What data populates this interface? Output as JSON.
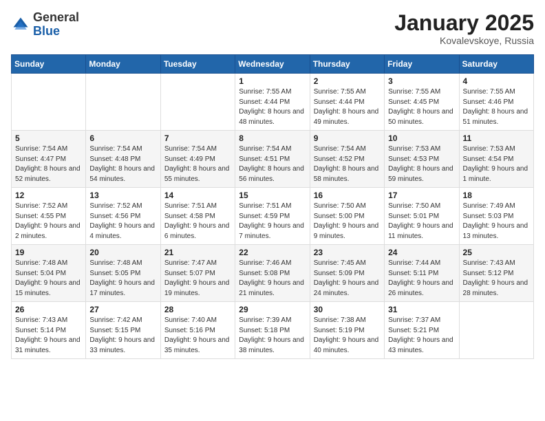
{
  "logo": {
    "general": "General",
    "blue": "Blue"
  },
  "header": {
    "month": "January 2025",
    "location": "Kovalevskoye, Russia"
  },
  "weekdays": [
    "Sunday",
    "Monday",
    "Tuesday",
    "Wednesday",
    "Thursday",
    "Friday",
    "Saturday"
  ],
  "weeks": [
    [
      {
        "day": "",
        "sunrise": "",
        "sunset": "",
        "daylight": ""
      },
      {
        "day": "",
        "sunrise": "",
        "sunset": "",
        "daylight": ""
      },
      {
        "day": "",
        "sunrise": "",
        "sunset": "",
        "daylight": ""
      },
      {
        "day": "1",
        "sunrise": "Sunrise: 7:55 AM",
        "sunset": "Sunset: 4:44 PM",
        "daylight": "Daylight: 8 hours and 48 minutes."
      },
      {
        "day": "2",
        "sunrise": "Sunrise: 7:55 AM",
        "sunset": "Sunset: 4:44 PM",
        "daylight": "Daylight: 8 hours and 49 minutes."
      },
      {
        "day": "3",
        "sunrise": "Sunrise: 7:55 AM",
        "sunset": "Sunset: 4:45 PM",
        "daylight": "Daylight: 8 hours and 50 minutes."
      },
      {
        "day": "4",
        "sunrise": "Sunrise: 7:55 AM",
        "sunset": "Sunset: 4:46 PM",
        "daylight": "Daylight: 8 hours and 51 minutes."
      }
    ],
    [
      {
        "day": "5",
        "sunrise": "Sunrise: 7:54 AM",
        "sunset": "Sunset: 4:47 PM",
        "daylight": "Daylight: 8 hours and 52 minutes."
      },
      {
        "day": "6",
        "sunrise": "Sunrise: 7:54 AM",
        "sunset": "Sunset: 4:48 PM",
        "daylight": "Daylight: 8 hours and 54 minutes."
      },
      {
        "day": "7",
        "sunrise": "Sunrise: 7:54 AM",
        "sunset": "Sunset: 4:49 PM",
        "daylight": "Daylight: 8 hours and 55 minutes."
      },
      {
        "day": "8",
        "sunrise": "Sunrise: 7:54 AM",
        "sunset": "Sunset: 4:51 PM",
        "daylight": "Daylight: 8 hours and 56 minutes."
      },
      {
        "day": "9",
        "sunrise": "Sunrise: 7:54 AM",
        "sunset": "Sunset: 4:52 PM",
        "daylight": "Daylight: 8 hours and 58 minutes."
      },
      {
        "day": "10",
        "sunrise": "Sunrise: 7:53 AM",
        "sunset": "Sunset: 4:53 PM",
        "daylight": "Daylight: 8 hours and 59 minutes."
      },
      {
        "day": "11",
        "sunrise": "Sunrise: 7:53 AM",
        "sunset": "Sunset: 4:54 PM",
        "daylight": "Daylight: 9 hours and 1 minute."
      }
    ],
    [
      {
        "day": "12",
        "sunrise": "Sunrise: 7:52 AM",
        "sunset": "Sunset: 4:55 PM",
        "daylight": "Daylight: 9 hours and 2 minutes."
      },
      {
        "day": "13",
        "sunrise": "Sunrise: 7:52 AM",
        "sunset": "Sunset: 4:56 PM",
        "daylight": "Daylight: 9 hours and 4 minutes."
      },
      {
        "day": "14",
        "sunrise": "Sunrise: 7:51 AM",
        "sunset": "Sunset: 4:58 PM",
        "daylight": "Daylight: 9 hours and 6 minutes."
      },
      {
        "day": "15",
        "sunrise": "Sunrise: 7:51 AM",
        "sunset": "Sunset: 4:59 PM",
        "daylight": "Daylight: 9 hours and 7 minutes."
      },
      {
        "day": "16",
        "sunrise": "Sunrise: 7:50 AM",
        "sunset": "Sunset: 5:00 PM",
        "daylight": "Daylight: 9 hours and 9 minutes."
      },
      {
        "day": "17",
        "sunrise": "Sunrise: 7:50 AM",
        "sunset": "Sunset: 5:01 PM",
        "daylight": "Daylight: 9 hours and 11 minutes."
      },
      {
        "day": "18",
        "sunrise": "Sunrise: 7:49 AM",
        "sunset": "Sunset: 5:03 PM",
        "daylight": "Daylight: 9 hours and 13 minutes."
      }
    ],
    [
      {
        "day": "19",
        "sunrise": "Sunrise: 7:48 AM",
        "sunset": "Sunset: 5:04 PM",
        "daylight": "Daylight: 9 hours and 15 minutes."
      },
      {
        "day": "20",
        "sunrise": "Sunrise: 7:48 AM",
        "sunset": "Sunset: 5:05 PM",
        "daylight": "Daylight: 9 hours and 17 minutes."
      },
      {
        "day": "21",
        "sunrise": "Sunrise: 7:47 AM",
        "sunset": "Sunset: 5:07 PM",
        "daylight": "Daylight: 9 hours and 19 minutes."
      },
      {
        "day": "22",
        "sunrise": "Sunrise: 7:46 AM",
        "sunset": "Sunset: 5:08 PM",
        "daylight": "Daylight: 9 hours and 21 minutes."
      },
      {
        "day": "23",
        "sunrise": "Sunrise: 7:45 AM",
        "sunset": "Sunset: 5:09 PM",
        "daylight": "Daylight: 9 hours and 24 minutes."
      },
      {
        "day": "24",
        "sunrise": "Sunrise: 7:44 AM",
        "sunset": "Sunset: 5:11 PM",
        "daylight": "Daylight: 9 hours and 26 minutes."
      },
      {
        "day": "25",
        "sunrise": "Sunrise: 7:43 AM",
        "sunset": "Sunset: 5:12 PM",
        "daylight": "Daylight: 9 hours and 28 minutes."
      }
    ],
    [
      {
        "day": "26",
        "sunrise": "Sunrise: 7:43 AM",
        "sunset": "Sunset: 5:14 PM",
        "daylight": "Daylight: 9 hours and 31 minutes."
      },
      {
        "day": "27",
        "sunrise": "Sunrise: 7:42 AM",
        "sunset": "Sunset: 5:15 PM",
        "daylight": "Daylight: 9 hours and 33 minutes."
      },
      {
        "day": "28",
        "sunrise": "Sunrise: 7:40 AM",
        "sunset": "Sunset: 5:16 PM",
        "daylight": "Daylight: 9 hours and 35 minutes."
      },
      {
        "day": "29",
        "sunrise": "Sunrise: 7:39 AM",
        "sunset": "Sunset: 5:18 PM",
        "daylight": "Daylight: 9 hours and 38 minutes."
      },
      {
        "day": "30",
        "sunrise": "Sunrise: 7:38 AM",
        "sunset": "Sunset: 5:19 PM",
        "daylight": "Daylight: 9 hours and 40 minutes."
      },
      {
        "day": "31",
        "sunrise": "Sunrise: 7:37 AM",
        "sunset": "Sunset: 5:21 PM",
        "daylight": "Daylight: 9 hours and 43 minutes."
      },
      {
        "day": "",
        "sunrise": "",
        "sunset": "",
        "daylight": ""
      }
    ]
  ]
}
